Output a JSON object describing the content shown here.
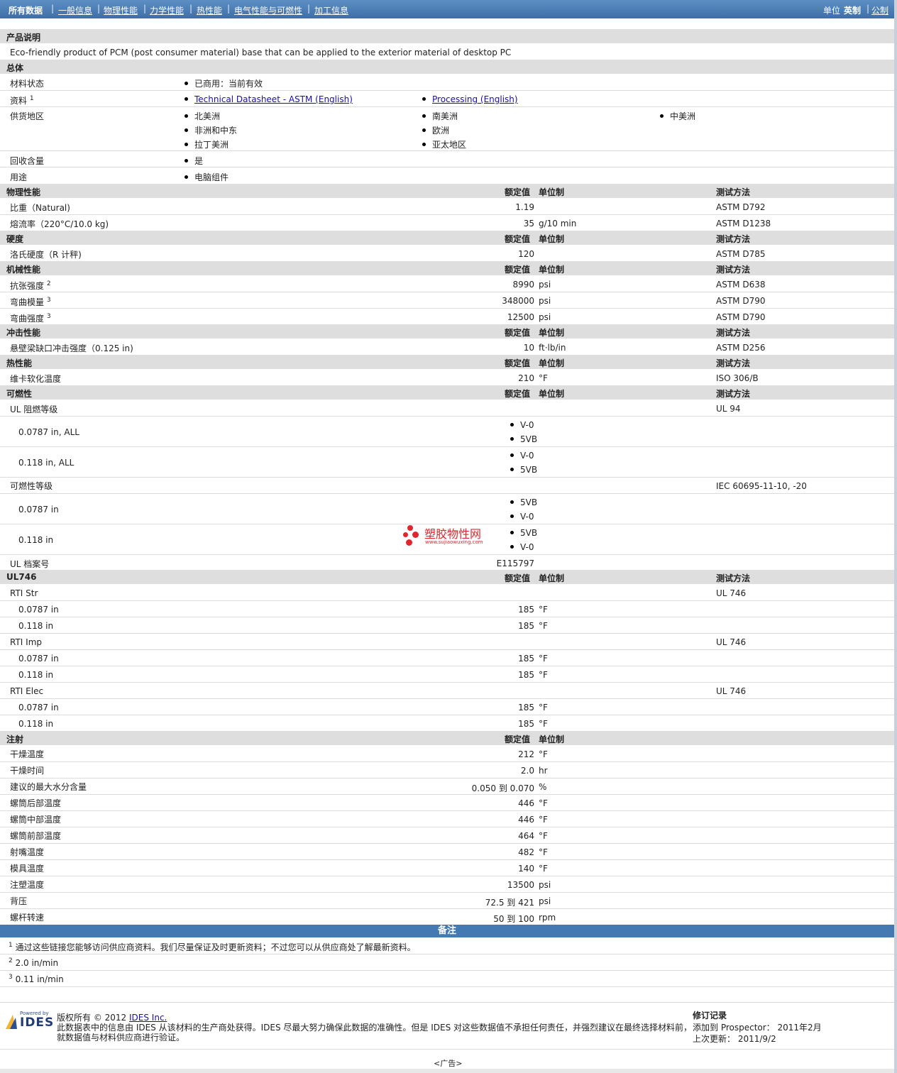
{
  "nav": {
    "items": [
      "所有数据",
      "一般信息",
      "物理性能",
      "力学性能",
      "热性能",
      "电气性能与可燃性",
      "加工信息"
    ],
    "units_label": "单位",
    "unit_english": "英制",
    "unit_metric": "公制"
  },
  "desc": {
    "heading": "产品说明",
    "text": "Eco-friendly product of PCM (post consumer material) base that can be applied to the exterior material of desktop PC"
  },
  "general": {
    "heading": "总体",
    "status_label": "材料状态",
    "status_value": "已商用：当前有效",
    "docs_label": "资料",
    "docs_sup": "1",
    "doc1": "Technical Datasheet - ASTM (English)",
    "doc2": "Processing (English)",
    "region_label": "供货地区",
    "regions": [
      "北美洲",
      "南美洲",
      "中美洲",
      "非洲和中东",
      "欧洲",
      "拉丁美洲",
      "亚太地区"
    ],
    "recycled_label": "回收含量",
    "recycled_value": "是",
    "use_label": "用途",
    "use_value": "电脑组件"
  },
  "col": {
    "nominal": "额定值",
    "unit": "单位制",
    "method": "测试方法"
  },
  "physical": {
    "heading": "物理性能",
    "rows": [
      {
        "name": "比重（Natural)",
        "value": "1.19",
        "unit": "",
        "method": "ASTM D792"
      },
      {
        "name": "熔流率（220°C/10.0 kg)",
        "value": "35",
        "unit": "g/10 min",
        "method": "ASTM D1238"
      }
    ]
  },
  "hardness": {
    "heading": "硬度",
    "rows": [
      {
        "name": "洛氏硬度（R 计秤)",
        "value": "120",
        "unit": "",
        "method": "ASTM D785"
      }
    ]
  },
  "mechanical": {
    "heading": "机械性能",
    "rows": [
      {
        "name": "抗张强度",
        "sup": "2",
        "value": "8990",
        "unit": "psi",
        "method": "ASTM D638"
      },
      {
        "name": "弯曲模量",
        "sup": "3",
        "value": "348000",
        "unit": "psi",
        "method": "ASTM D790"
      },
      {
        "name": "弯曲强度",
        "sup": "3",
        "value": "12500",
        "unit": "psi",
        "method": "ASTM D790"
      }
    ]
  },
  "impact": {
    "heading": "冲击性能",
    "rows": [
      {
        "name": "悬壁梁缺口冲击强度（0.125 in)",
        "value": "10",
        "unit": "ft·lb/in",
        "method": "ASTM D256"
      }
    ]
  },
  "thermal": {
    "heading": "热性能",
    "rows": [
      {
        "name": "维卡软化温度",
        "value": "210",
        "unit": "°F",
        "method": "ISO 306/B"
      }
    ]
  },
  "flammability": {
    "heading": "可燃性",
    "ul_label": "UL 阻燃等级",
    "ul_method": "UL 94",
    "ul_rows": [
      {
        "name": "0.0787 in, ALL",
        "v1": "V-0",
        "v2": "5VB"
      },
      {
        "name": "0.118 in, ALL",
        "v1": "V-0",
        "v2": "5VB"
      }
    ],
    "flam_label": "可燃性等级",
    "flam_method": "IEC 60695-11-10, -20",
    "flam_rows": [
      {
        "name": "0.0787 in",
        "v1": "5VB",
        "v2": "V-0"
      },
      {
        "name": "0.118 in",
        "v1": "5VB",
        "v2": "V-0"
      }
    ],
    "file_label": "UL 档案号",
    "file_value": "E115797"
  },
  "ul746": {
    "heading": "UL746",
    "groups": [
      {
        "name": "RTI Str",
        "method": "UL 746",
        "rows": [
          {
            "name": "0.0787 in",
            "value": "185",
            "unit": "°F"
          },
          {
            "name": "0.118 in",
            "value": "185",
            "unit": "°F"
          }
        ]
      },
      {
        "name": "RTI Imp",
        "method": "UL 746",
        "rows": [
          {
            "name": "0.0787 in",
            "value": "185",
            "unit": "°F"
          },
          {
            "name": "0.118 in",
            "value": "185",
            "unit": "°F"
          }
        ]
      },
      {
        "name": "RTI Elec",
        "method": "UL 746",
        "rows": [
          {
            "name": "0.0787 in",
            "value": "185",
            "unit": "°F"
          },
          {
            "name": "0.118 in",
            "value": "185",
            "unit": "°F"
          }
        ]
      }
    ]
  },
  "injection": {
    "heading": "注射",
    "rows": [
      {
        "name": "干燥温度",
        "value": "212",
        "unit": "°F"
      },
      {
        "name": "干燥时间",
        "value": "2.0",
        "unit": "hr"
      },
      {
        "name": "建议的最大水分含量",
        "value": "0.050 到  0.070",
        "unit": "%"
      },
      {
        "name": "螺筒后部温度",
        "value": "446",
        "unit": "°F"
      },
      {
        "name": "螺筒中部温度",
        "value": "446",
        "unit": "°F"
      },
      {
        "name": "螺筒前部温度",
        "value": "464",
        "unit": "°F"
      },
      {
        "name": "射嘴温度",
        "value": "482",
        "unit": "°F"
      },
      {
        "name": "模具温度",
        "value": "140",
        "unit": "°F"
      },
      {
        "name": "注塑温度",
        "value": "13500",
        "unit": "psi"
      },
      {
        "name": "背压",
        "value": "72.5 到  421",
        "unit": "psi"
      },
      {
        "name": "螺杆转速",
        "value": "50 到  100",
        "unit": "rpm"
      }
    ]
  },
  "notes": {
    "heading": "备注",
    "items": [
      {
        "sup": "1",
        "text": "通过这些链接您能够访问供应商资料。我们尽量保证及时更新资料；不过您可以从供应商处了解最新资料。"
      },
      {
        "sup": "2",
        "text": "2.0 in/min"
      },
      {
        "sup": "3",
        "text": "0.11 in/min"
      }
    ]
  },
  "watermark": {
    "title": "塑胶物性网",
    "url": "www.sujiaowuxing.com"
  },
  "footer": {
    "logo_top": "Powered by",
    "logo_text": "IDES",
    "copyright": "版权所有  © 2012",
    "company_link": "IDES Inc.",
    "disclaimer1": "此数据表中的信息由  IDES 从该材料的生产商处获得。IDES 尽最大努力确保此数据的准确性。但是  IDES 对这些数据值不承担任何责任，并强烈建议在最终选择材料前，",
    "disclaimer2": "就数据值与材料供应商进行验证。",
    "rev_heading": "修订记录",
    "added_label": "添加到  Prospector：  2011年2月",
    "updated_label": "上次更新：   2011/9/2",
    "ad": "<广告>"
  }
}
